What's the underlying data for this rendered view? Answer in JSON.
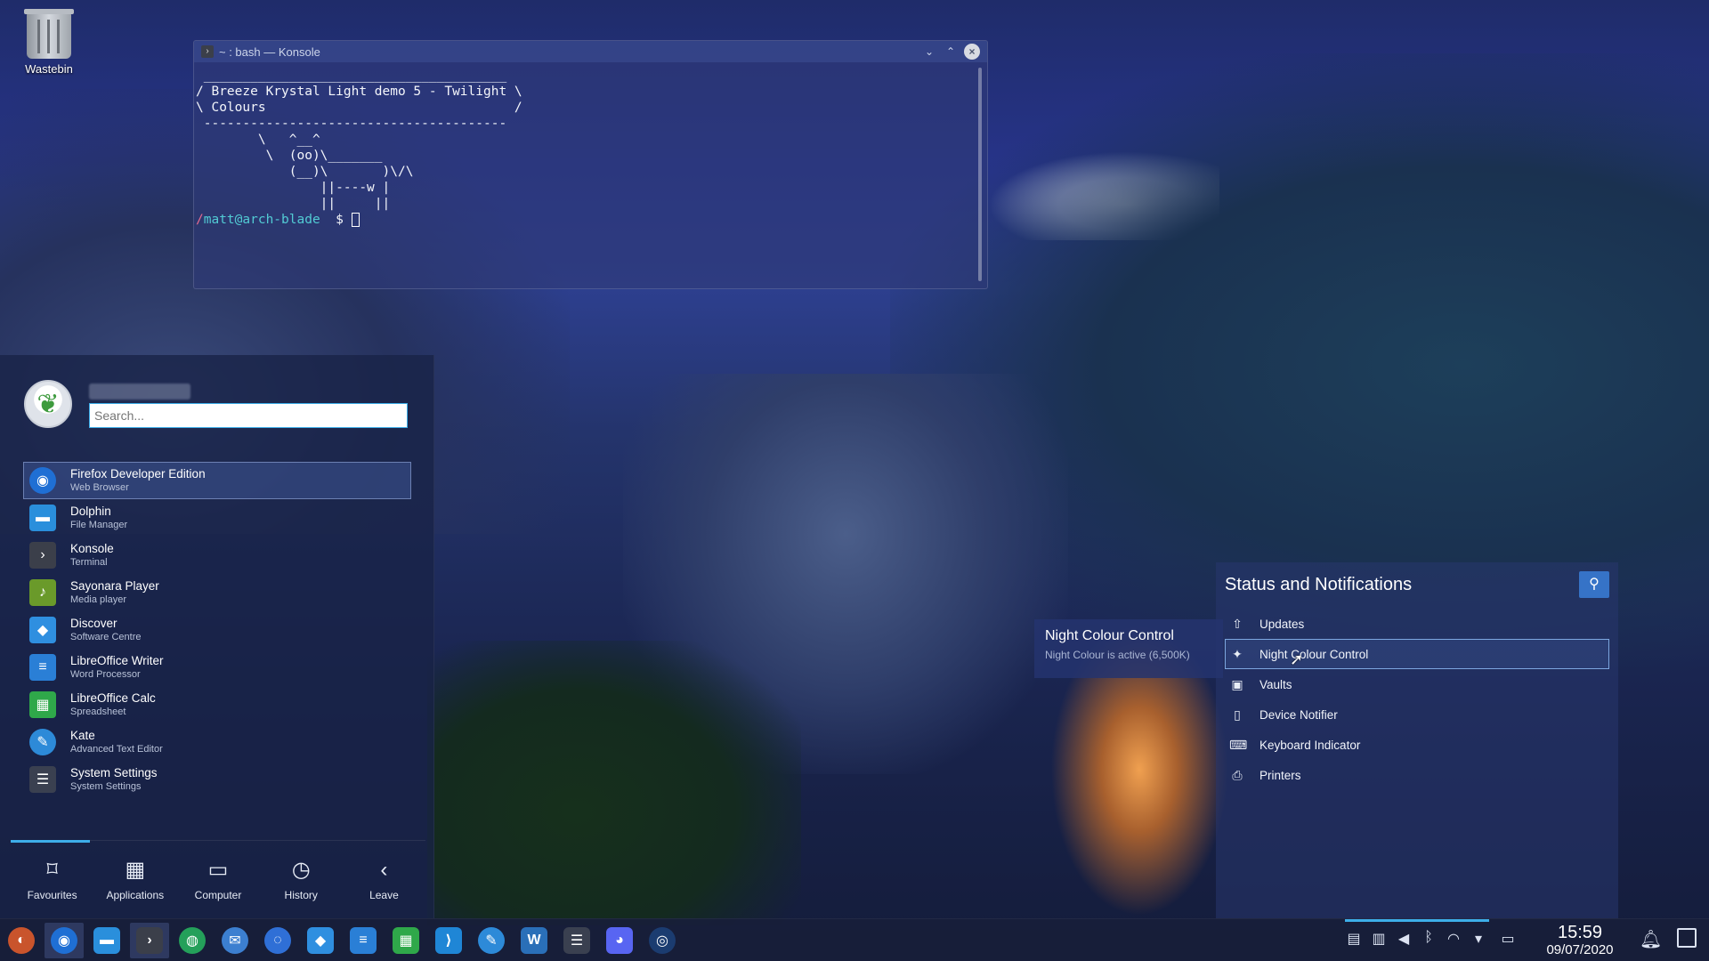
{
  "desktop": {
    "wastebin_label": "Wastebin"
  },
  "konsole": {
    "title": "~ : bash — Konsole",
    "lines": [
      " _______________________________________",
      "/ Breeze Krystal Light demo 5 - Twilight \\",
      "\\ Colours                                /",
      " ---------------------------------------",
      "        \\   ^__^",
      "         \\  (oo)\\_______",
      "            (__)\\       )\\/\\",
      "                ||----w |",
      "                ||     ||"
    ],
    "prompt_path": "/",
    "prompt_user": "matt@arch-blade",
    "prompt_suffix": "  $ "
  },
  "launcher": {
    "search_placeholder": "Search...",
    "apps": [
      {
        "name": "Firefox Developer Edition",
        "desc": "Web Browser",
        "icon": "firefox-icon",
        "color": "#1f6fd4",
        "glyph": "◉"
      },
      {
        "name": "Dolphin",
        "desc": "File Manager",
        "icon": "folder-icon",
        "color": "#2a8fdc",
        "glyph": "▬"
      },
      {
        "name": "Konsole",
        "desc": "Terminal",
        "icon": "terminal-icon",
        "color": "#3b3f4a",
        "glyph": "›"
      },
      {
        "name": "Sayonara Player",
        "desc": "Media player",
        "icon": "sayonara-icon",
        "color": "#6a9a2a",
        "glyph": "♪"
      },
      {
        "name": "Discover",
        "desc": "Software Centre",
        "icon": "discover-icon",
        "color": "#2f8fe0",
        "glyph": "◆"
      },
      {
        "name": "LibreOffice Writer",
        "desc": "Word Processor",
        "icon": "writer-icon",
        "color": "#2a7fd6",
        "glyph": "≡"
      },
      {
        "name": "LibreOffice Calc",
        "desc": "Spreadsheet",
        "icon": "calc-icon",
        "color": "#2fa84a",
        "glyph": "▦"
      },
      {
        "name": "Kate",
        "desc": "Advanced Text Editor",
        "icon": "kate-icon",
        "color": "#2d8ad8",
        "glyph": "✎"
      },
      {
        "name": "System Settings",
        "desc": "System Settings",
        "icon": "settings-icon",
        "color": "#3a4050",
        "glyph": "☰"
      }
    ],
    "tabs": [
      {
        "label": "Favourites",
        "icon": "bookmark-icon",
        "glyph": "⌑"
      },
      {
        "label": "Applications",
        "icon": "grid-icon",
        "glyph": "▦"
      },
      {
        "label": "Computer",
        "icon": "computer-icon",
        "glyph": "▭"
      },
      {
        "label": "History",
        "icon": "clock-icon",
        "glyph": "◷"
      },
      {
        "label": "Leave",
        "icon": "leave-icon",
        "glyph": "‹"
      }
    ]
  },
  "status": {
    "title": "Status and Notifications",
    "items": [
      {
        "label": "Updates",
        "icon": "updates-icon",
        "glyph": "⇧"
      },
      {
        "label": "Night Colour Control",
        "icon": "bulb-icon",
        "glyph": "✦"
      },
      {
        "label": "Vaults",
        "icon": "vault-icon",
        "glyph": "▣"
      },
      {
        "label": "Device Notifier",
        "icon": "device-icon",
        "glyph": "▯"
      },
      {
        "label": "Keyboard Indicator",
        "icon": "keyboard-icon",
        "glyph": "⌨"
      },
      {
        "label": "Printers",
        "icon": "printer-icon",
        "glyph": "⎙"
      }
    ]
  },
  "tooltip": {
    "title": "Night Colour Control",
    "subtitle": "Night Colour is active (6,500K)"
  },
  "taskbar": {
    "tasks": [
      {
        "icon": "launcher-icon",
        "color": "#c9542c",
        "glyph": "◐"
      },
      {
        "icon": "firefox-icon",
        "color": "#1f6fd4",
        "glyph": "◉"
      },
      {
        "icon": "folder-icon",
        "color": "#2a8fdc",
        "glyph": "▬"
      },
      {
        "icon": "terminal-icon",
        "color": "#3b3f4a",
        "glyph": "›"
      },
      {
        "icon": "sayonara-icon",
        "color": "#24a05a",
        "glyph": "◍"
      },
      {
        "icon": "thunderbird-icon",
        "color": "#3c7fd0",
        "glyph": "✉"
      },
      {
        "icon": "camera-icon",
        "color": "#2f6fd6",
        "glyph": "◌"
      },
      {
        "icon": "discover-icon",
        "color": "#2f8fe0",
        "glyph": "◆"
      },
      {
        "icon": "writer-icon",
        "color": "#2a7fd6",
        "glyph": "≡"
      },
      {
        "icon": "calc-icon",
        "color": "#2fa84a",
        "glyph": "▦"
      },
      {
        "icon": "vscode-icon",
        "color": "#1f86d6",
        "glyph": "⟩"
      },
      {
        "icon": "kate-icon",
        "color": "#2d8ad8",
        "glyph": "✎"
      },
      {
        "icon": "webstorm-icon",
        "color": "#2a6fb8",
        "glyph": "W"
      },
      {
        "icon": "settings-icon",
        "color": "#3a4050",
        "glyph": "☰"
      },
      {
        "icon": "discord-icon",
        "color": "#5865f2",
        "glyph": "◕"
      },
      {
        "icon": "steam-icon",
        "color": "#1b3c70",
        "glyph": "◎"
      }
    ],
    "time": "15:59",
    "date": "09/07/2020"
  }
}
